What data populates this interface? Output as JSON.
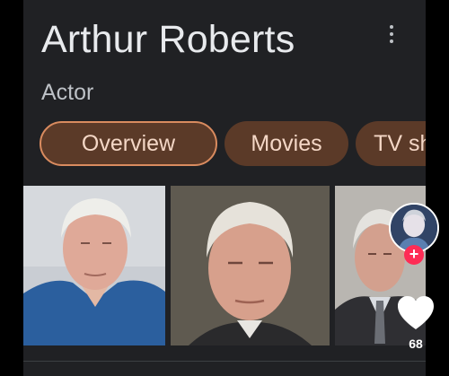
{
  "header": {
    "title": "Arthur Roberts",
    "subtitle": "Actor",
    "more_icon": "more-vert-icon"
  },
  "tabs": [
    {
      "label": "Overview",
      "active": true
    },
    {
      "label": "Movies",
      "active": false
    },
    {
      "label": "TV shows",
      "active": false
    }
  ],
  "social": {
    "like_count": "68",
    "follow_badge": "+"
  },
  "colors": {
    "panel_bg": "#202124",
    "chip_bg": "#5b3a28",
    "chip_text": "#f4d7c6",
    "chip_active_border": "#d98b5f",
    "like_heart": "#ffffff",
    "follow_badge": "#fe2c55"
  }
}
